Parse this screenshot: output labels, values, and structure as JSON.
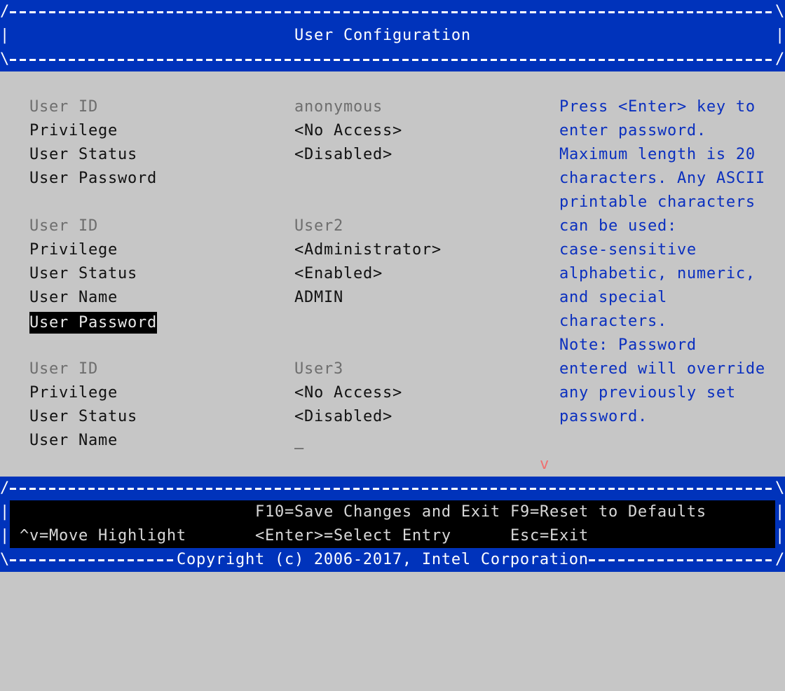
{
  "header": {
    "title": "User Configuration",
    "corner_top_left": "/",
    "corner_top_right": "\\",
    "corner_bottom_left": "\\",
    "corner_bottom_right": "/",
    "side": "|"
  },
  "users": [
    {
      "id_label": "User ID",
      "id_value": "anonymous",
      "fields": [
        {
          "label": "Privilege",
          "value": "<No Access>"
        },
        {
          "label": "User Status",
          "value": "<Disabled>"
        },
        {
          "label": "User Password",
          "value": ""
        }
      ]
    },
    {
      "id_label": "User ID",
      "id_value": "User2",
      "fields": [
        {
          "label": "Privilege",
          "value": "<Administrator>"
        },
        {
          "label": "User Status",
          "value": "<Enabled>"
        },
        {
          "label": "User Name",
          "value": "ADMIN"
        },
        {
          "label": "User Password",
          "value": "",
          "selected": true
        }
      ]
    },
    {
      "id_label": "User ID",
      "id_value": "User3",
      "fields": [
        {
          "label": "Privilege",
          "value": "<No Access>"
        },
        {
          "label": "User Status",
          "value": "<Disabled>"
        },
        {
          "label": "User Name",
          "value": "_"
        }
      ]
    }
  ],
  "help": {
    "lines": [
      "Press <Enter> key to",
      "enter password.",
      "Maximum length is 20",
      "characters. Any ASCII",
      "printable characters",
      "can be used:",
      "case-sensitive",
      "alphabetic, numeric,",
      "and special",
      "characters.",
      "Note: Password",
      "entered will override",
      "any previously set",
      "password."
    ]
  },
  "scroll_indicator": "v",
  "footer": {
    "side": "|",
    "corner_top_left": "/",
    "corner_top_right": "\\",
    "corner_bottom_left": "\\",
    "corner_bottom_right": "/",
    "f10": "F10=Save Changes and Exit",
    "f9": "F9=Reset to Defaults",
    "move": "^v=Move Highlight",
    "enter": "<Enter>=Select Entry",
    "esc": "Esc=Exit",
    "copyright": "Copyright (c) 2006-2017, Intel Corporation"
  },
  "colors": {
    "band_blue": "#0033bb",
    "background_gray": "#c6c6c6",
    "help_blue": "#0a2fbf",
    "disabled_gray": "#6e6e6e",
    "scroll_arrow": "#f07070"
  }
}
